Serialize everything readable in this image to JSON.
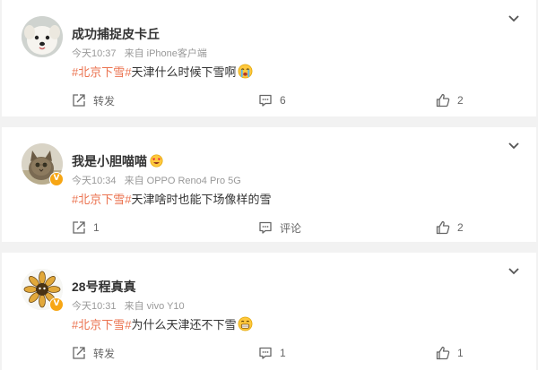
{
  "colors": {
    "hashtag": "#eb7350",
    "background": "#f2f2f2",
    "card": "#ffffff",
    "meta": "#999999",
    "badge": "#f7a614"
  },
  "comments": [
    {
      "username": "成功捕捉皮卡丘",
      "time": "今天10:37",
      "source": "来自 iPhone客户端",
      "hashtag": "#北京下雪#",
      "text": "天津什么时候下雪啊",
      "emoji": "crying-face-emoji",
      "avatar": "white-dog-avatar",
      "actions": {
        "forward": "转发",
        "comment": "6",
        "like": "2"
      }
    },
    {
      "username": "我是小胆喵喵",
      "name_emoji": "heart-eyes-emoji",
      "verified_badge": "V",
      "time": "今天10:34",
      "source": "来自 OPPO Reno4 Pro 5G",
      "hashtag": "#北京下雪#",
      "text": "天津啥时也能下场像样的雪",
      "avatar": "cat-avatar",
      "actions": {
        "forward": "1",
        "comment": "评论",
        "like": "2"
      }
    },
    {
      "username": "28号程真真",
      "verified_badge": "V",
      "time": "今天10:31",
      "source": "来自 vivo Y10",
      "hashtag": "#北京下雪#",
      "text": "为什么天津还不下雪",
      "emoji": "grinning-face-emoji",
      "avatar": "sunflower-avatar",
      "actions": {
        "forward": "转发",
        "comment": "1",
        "like": "1"
      }
    }
  ]
}
